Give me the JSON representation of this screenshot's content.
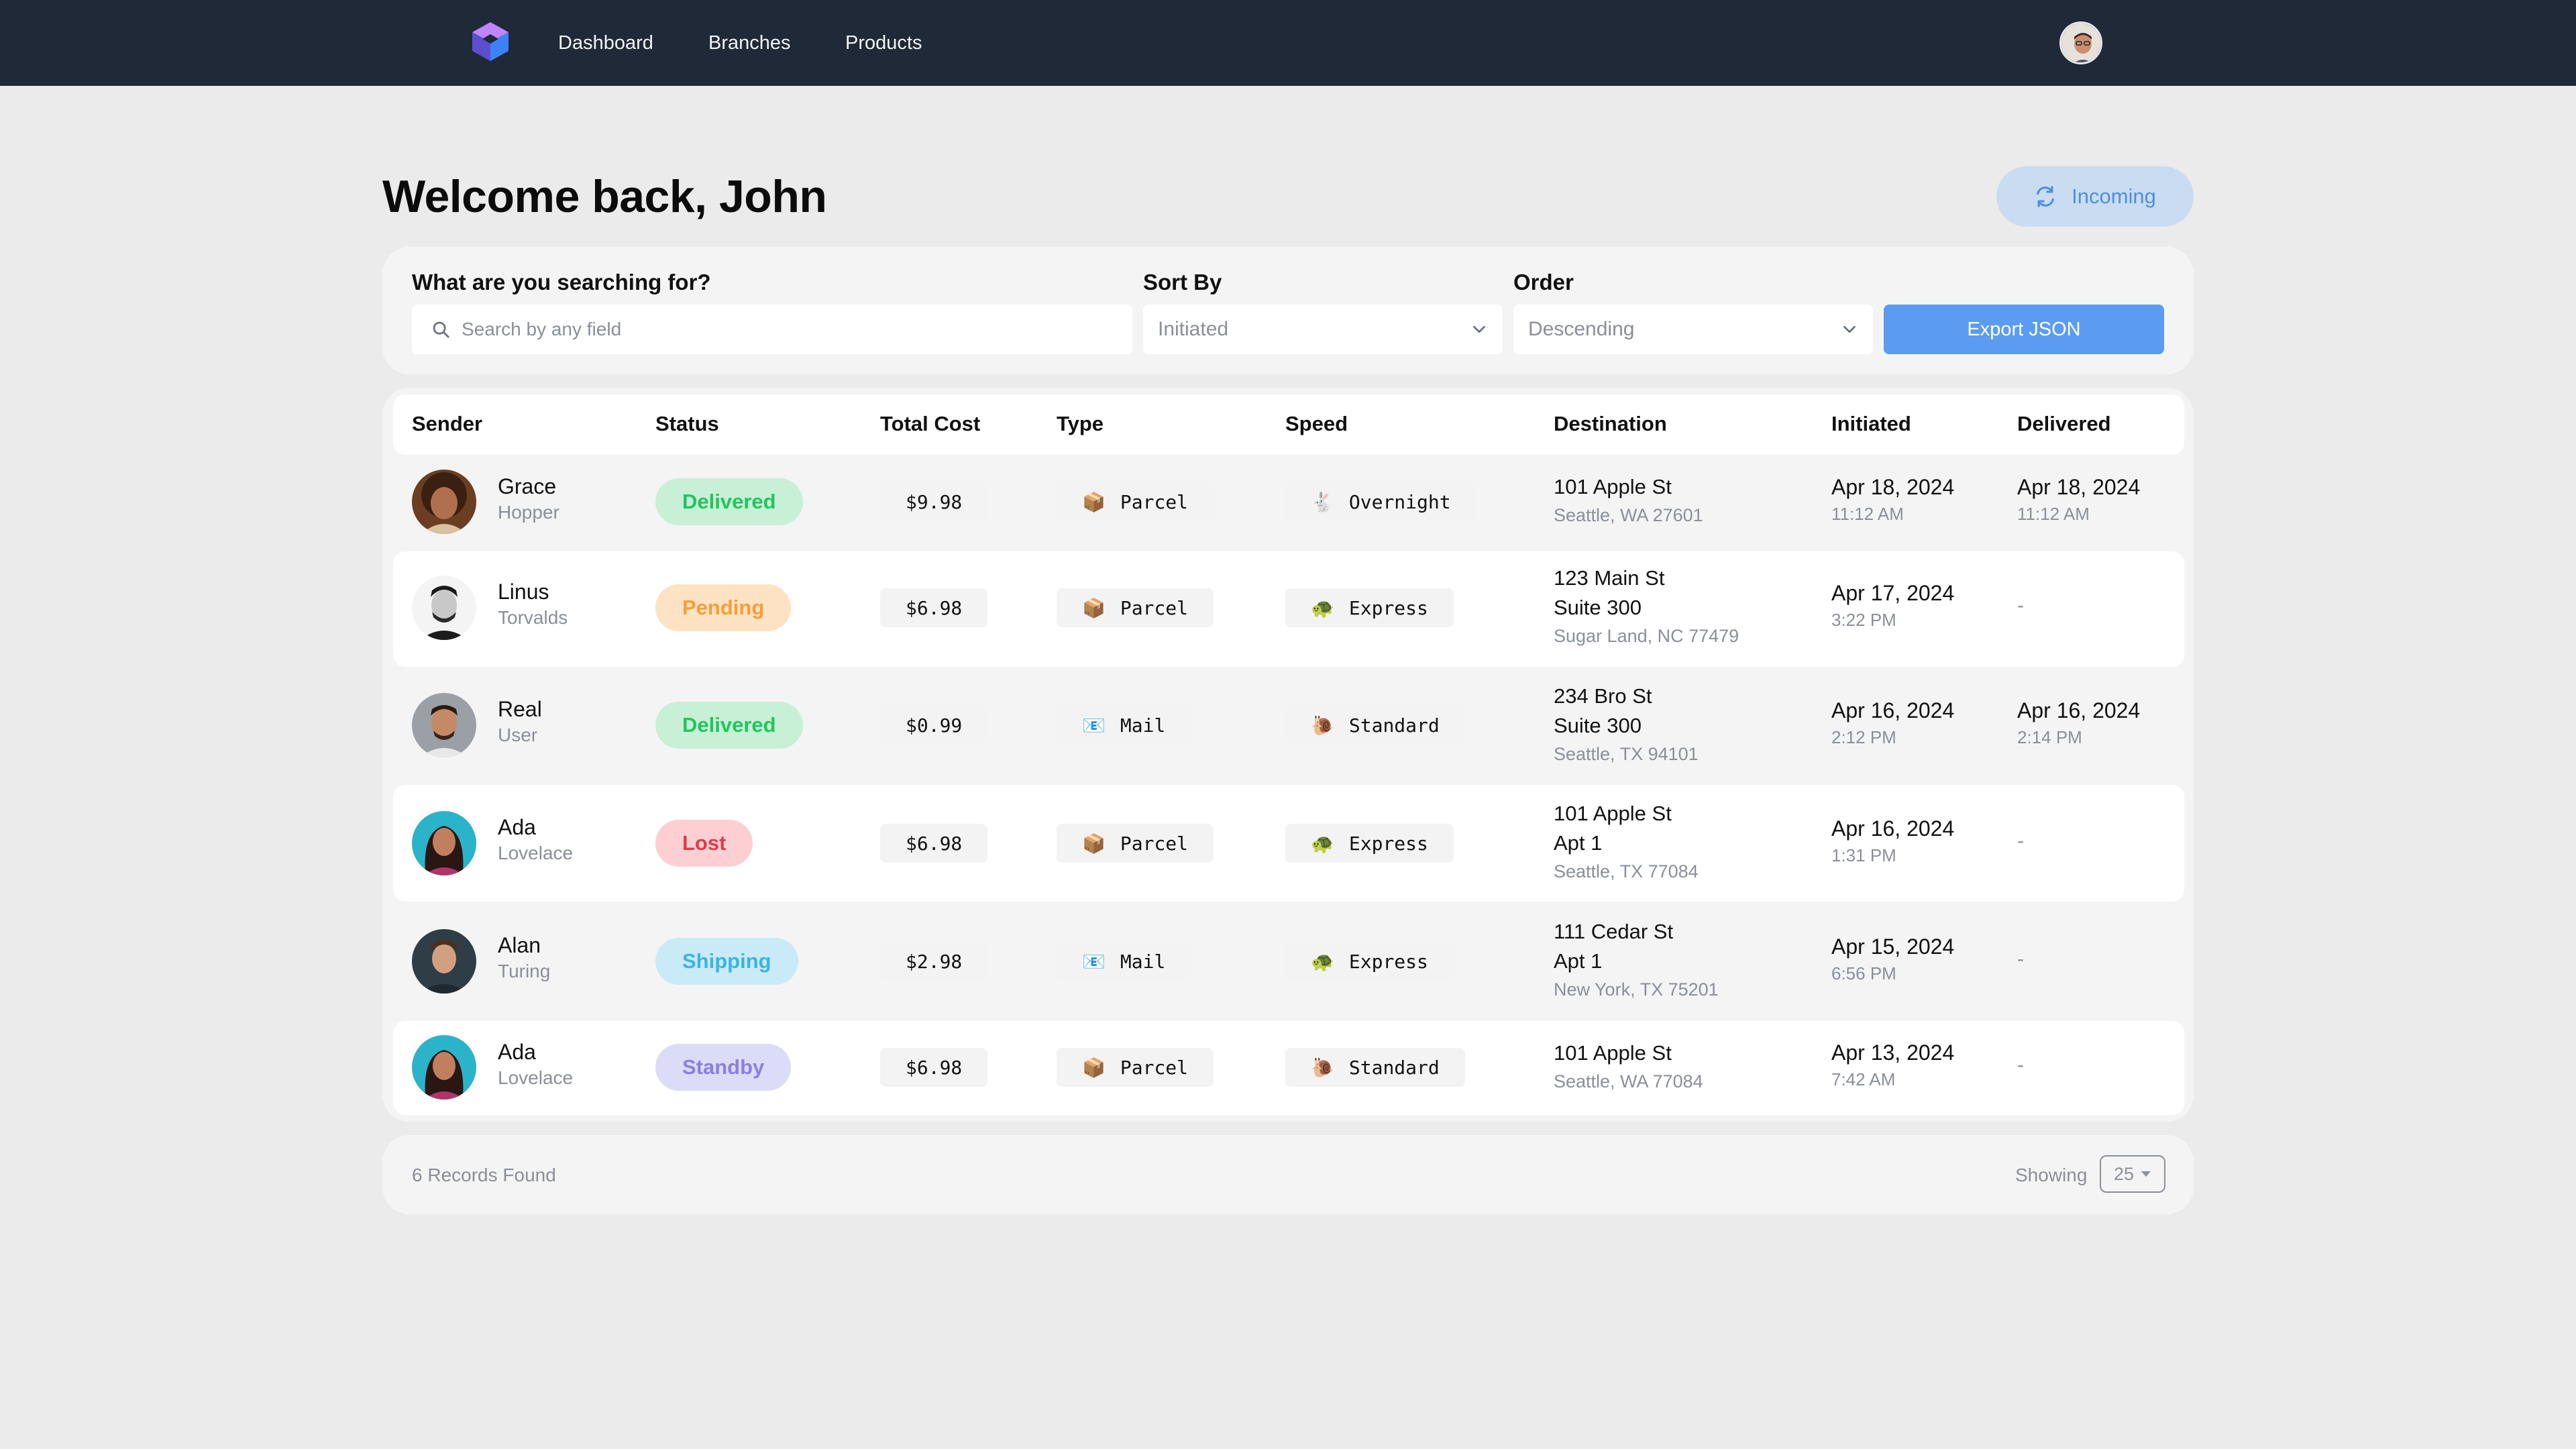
{
  "nav": {
    "links": [
      "Dashboard",
      "Branches",
      "Products"
    ]
  },
  "header": {
    "welcome": "Welcome back, John",
    "incoming_label": "Incoming"
  },
  "search": {
    "label": "What are you searching for?",
    "placeholder": "Search by any field",
    "sort_label": "Sort By",
    "sort_value": "Initiated",
    "order_label": "Order",
    "order_value": "Descending",
    "export_label": "Export JSON"
  },
  "table": {
    "columns": [
      "Sender",
      "Status",
      "Total Cost",
      "Type",
      "Speed",
      "Destination",
      "Initiated",
      "Delivered"
    ],
    "rows": [
      {
        "first": "Grace",
        "last": "Hopper",
        "status": "Delivered",
        "cost": "$9.98",
        "type_icon": "📦",
        "type": "Parcel",
        "speed_icon": "🐇",
        "speed": "Overnight",
        "dest1": "101 Apple St",
        "dest2": "",
        "dest3": "Seattle, WA 27601",
        "init_date": "Apr 18, 2024",
        "init_time": "11:12 AM",
        "del_date": "Apr 18, 2024",
        "del_time": "11:12 AM"
      },
      {
        "first": "Linus",
        "last": "Torvalds",
        "status": "Pending",
        "cost": "$6.98",
        "type_icon": "📦",
        "type": "Parcel",
        "speed_icon": "🐢",
        "speed": "Express",
        "dest1": "123 Main St",
        "dest2": "Suite 300",
        "dest3": "Sugar Land, NC 77479",
        "init_date": "Apr 17, 2024",
        "init_time": "3:22 PM",
        "del_dash": "-"
      },
      {
        "first": "Real",
        "last": "User",
        "status": "Delivered",
        "cost": "$0.99",
        "type_icon": "📧",
        "type": "Mail",
        "speed_icon": "🐌",
        "speed": "Standard",
        "dest1": "234 Bro St",
        "dest2": "Suite 300",
        "dest3": "Seattle, TX 94101",
        "init_date": "Apr 16, 2024",
        "init_time": "2:12 PM",
        "del_date": "Apr 16, 2024",
        "del_time": "2:14 PM"
      },
      {
        "first": "Ada",
        "last": "Lovelace",
        "status": "Lost",
        "cost": "$6.98",
        "type_icon": "📦",
        "type": "Parcel",
        "speed_icon": "🐢",
        "speed": "Express",
        "dest1": "101 Apple St",
        "dest2": "Apt 1",
        "dest3": "Seattle, TX 77084",
        "init_date": "Apr 16, 2024",
        "init_time": "1:31 PM",
        "del_dash": "-"
      },
      {
        "first": "Alan",
        "last": "Turing",
        "status": "Shipping",
        "cost": "$2.98",
        "type_icon": "📧",
        "type": "Mail",
        "speed_icon": "🐢",
        "speed": "Express",
        "dest1": "111 Cedar St",
        "dest2": "Apt 1",
        "dest3": "New York, TX 75201",
        "init_date": "Apr 15, 2024",
        "init_time": "6:56 PM",
        "del_dash": "-"
      },
      {
        "first": "Ada",
        "last": "Lovelace",
        "status": "Standby",
        "cost": "$6.98",
        "type_icon": "📦",
        "type": "Parcel",
        "speed_icon": "🐌",
        "speed": "Standard",
        "dest1": "101 Apple St",
        "dest2": "",
        "dest3": "Seattle, WA 77084",
        "init_date": "Apr 13, 2024",
        "init_time": "7:42 AM",
        "del_dash": "-"
      }
    ]
  },
  "status_colors": {
    "Delivered": {
      "bg": "#c8f0d6",
      "fg": "#22c55e"
    },
    "Pending": {
      "bg": "#fde3c4",
      "fg": "#f59e3a"
    },
    "Lost": {
      "bg": "#fcd0d3",
      "fg": "#e23a4a"
    },
    "Shipping": {
      "bg": "#c9eaf7",
      "fg": "#3ab4e4"
    },
    "Standby": {
      "bg": "#dcdcf7",
      "fg": "#8b7fe0"
    }
  },
  "footer": {
    "records": "6 Records Found",
    "showing": "Showing",
    "page_size": "25"
  }
}
